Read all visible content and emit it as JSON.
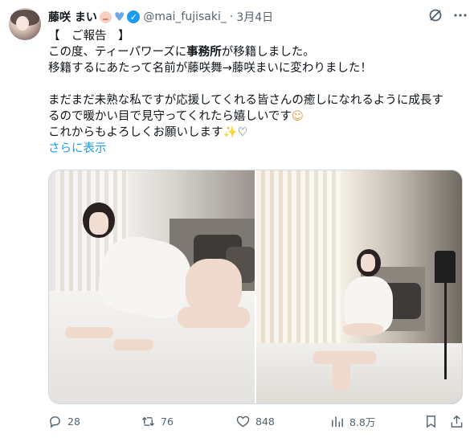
{
  "tweet": {
    "display_name": "藤咲 まい",
    "handle": "@mai_fujisaki_",
    "separator": "·",
    "date": "3月4日",
    "lines": [
      "【　ご報告　】",
      "この度、ティーパワーズに",
      "事務所",
      "が移籍しました。",
      "移籍するにあたって名前が藤咲舞→藤咲まいに変わりました！",
      "まだまだ未熟な私ですが応援してくれる皆さんの癒しになれるように成長す",
      "るので暖かい目で見守ってくれたら嬉しいです",
      "これからもよろしくお願いします"
    ],
    "show_more": "さらに表示",
    "emoji": {
      "smile": "☺",
      "sparkles": "✨",
      "heart_outline": "♡"
    }
  },
  "actions": {
    "replies": "28",
    "reposts": "76",
    "likes": "848",
    "views": "8.8万"
  },
  "icons": {
    "verified": "verified-badge-icon",
    "heart_emoji": "blue-heart-icon",
    "grok": "grok-icon",
    "more": "more-options-icon",
    "reply": "reply-icon",
    "repost": "repost-icon",
    "like": "like-icon",
    "views": "views-icon",
    "bookmark": "bookmark-icon",
    "share": "share-icon"
  },
  "colors": {
    "accent": "#1d9bf0",
    "text": "#0f1419",
    "muted": "#536471",
    "heart_emoji": "#6aa9e8"
  }
}
